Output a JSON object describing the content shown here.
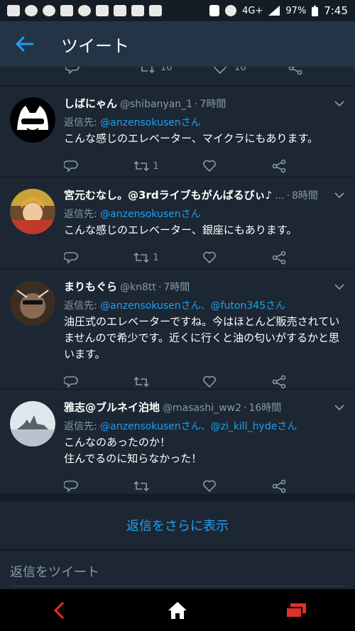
{
  "statusbar": {
    "network": "4G+",
    "battery": "97%",
    "time": "7:45"
  },
  "header": {
    "back_icon": "back-arrow-icon",
    "title": "ツイート"
  },
  "partial_tweet": {
    "retweet_count": "16",
    "like_count": "16"
  },
  "tweets": [
    {
      "name": "しばにゃん",
      "handle": "@shibanyan_1",
      "sep": "·",
      "time": "7時間",
      "reply_prefix": "返信先: ",
      "mentions": "@anzensokusenさん",
      "text": "こんな感じのエレベーター、マイクラにもあります。",
      "retweets": "1",
      "likes": ""
    },
    {
      "name": "宮元むなし。@3rdライブもがんばるびぃ♪",
      "handle": "...",
      "sep": "·",
      "time": "8時間",
      "reply_prefix": "返信先: ",
      "mentions": "@anzensokusenさん",
      "text": "こんな感じのエレベーター、銀座にもあります。",
      "retweets": "1",
      "likes": ""
    },
    {
      "name": "まりもぐら",
      "handle": "@kn8tt",
      "sep": "·",
      "time": "7時間",
      "reply_prefix": "返信先: ",
      "mentions": "@anzensokusenさん、@futon345さん",
      "text": "油圧式のエレベーターですね。今はほとんど販売されていませんので希少です。近くに行くと油の匂いがするかと思います。",
      "retweets": "",
      "likes": ""
    },
    {
      "name": "雅志@ブルネイ泊地",
      "handle": "@masashi_ww2",
      "sep": "·",
      "time": "16時間",
      "reply_prefix": "返信先: ",
      "mentions": "@anzensokusenさん、@zi_kill_hydeさん",
      "text_line1": "こんなのあったのか！",
      "text_line2": "住んでるのに知らなかった！",
      "retweets": "",
      "likes": ""
    }
  ],
  "more_replies": "返信をさらに表示",
  "reply_placeholder": "返信をツイート",
  "colors": {
    "background": "#1c2733",
    "header": "#243447",
    "accent": "#1da1f2",
    "muted": "#8899a6",
    "nav_back": "#e0312b",
    "nav_recents": "#e0312b"
  }
}
